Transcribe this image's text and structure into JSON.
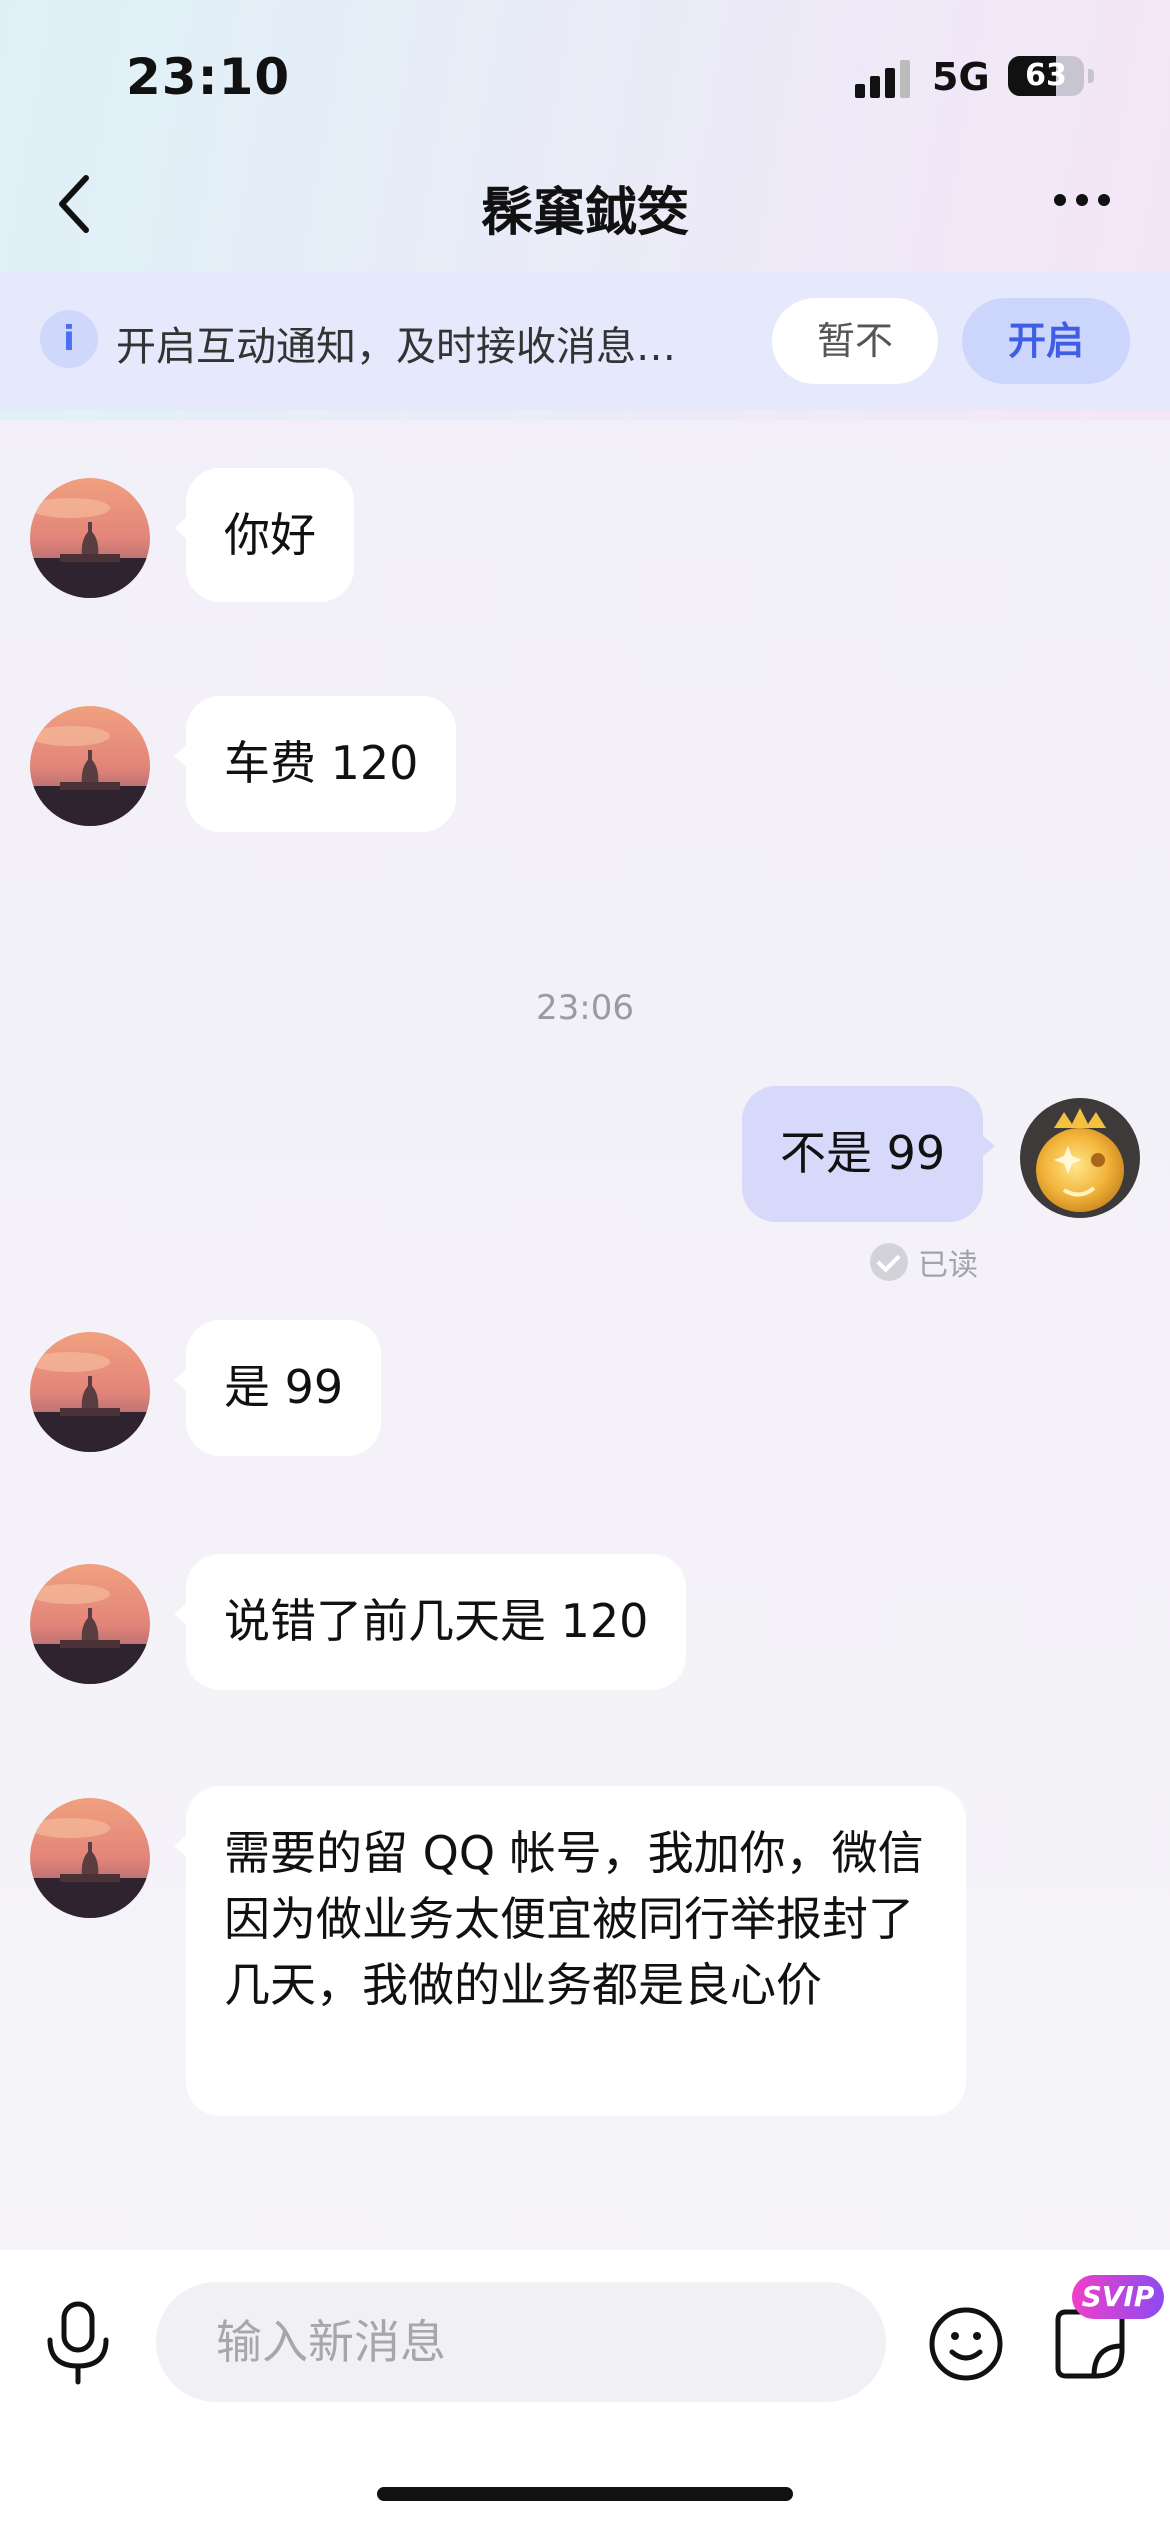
{
  "status_bar": {
    "time": "23:10",
    "network": "5G",
    "battery": "63"
  },
  "nav": {
    "title": "髹窼鉞筊",
    "back_icon": "chevron-left-icon",
    "more_icon": "more-icon"
  },
  "notice": {
    "text": "开启互动通知，及时接收消息…",
    "later_label": "暂不",
    "open_label": "开启",
    "icon": "info-icon"
  },
  "messages": [
    {
      "side": "left",
      "text": "你好"
    },
    {
      "side": "left",
      "text": "车费 120"
    },
    {
      "type": "timestamp",
      "text": "23:06"
    },
    {
      "side": "right",
      "text": "不是 99",
      "status": "已读"
    },
    {
      "side": "left",
      "text": "是 99"
    },
    {
      "side": "left",
      "text": "说错了前几天是 120"
    },
    {
      "side": "left",
      "text": "需要的留 QQ 帐号，我加你，微信因为做业务太便宜被同行举报封了几天，我做的业务都是良心价"
    }
  ],
  "input_bar": {
    "placeholder": "输入新消息",
    "mic_icon": "microphone-icon",
    "emoji_icon": "smiley-icon",
    "sticker_icon": "sticker-icon",
    "badge": "SVIP"
  },
  "colors": {
    "accent": "#3f5ee5",
    "my_bubble": "#d7d9fb",
    "their_bubble": "#ffffff"
  }
}
